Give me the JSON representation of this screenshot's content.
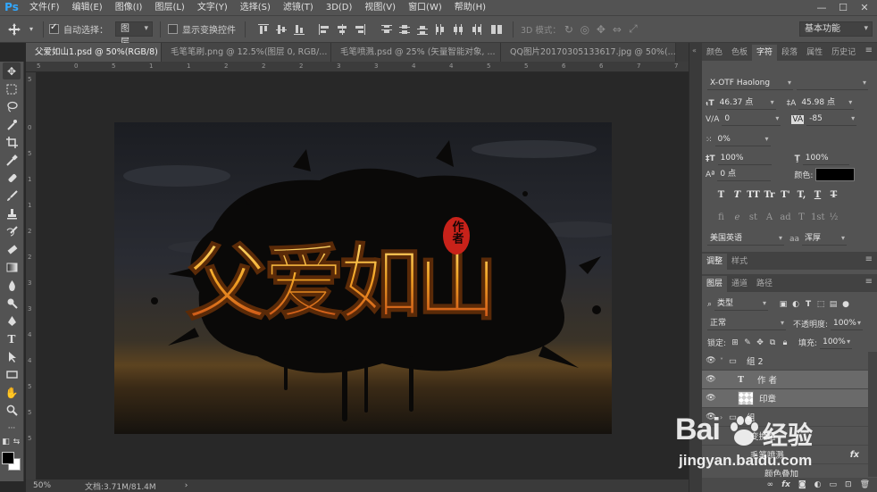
{
  "app": {
    "logo": "Ps"
  },
  "menu": [
    "文件(F)",
    "编辑(E)",
    "图像(I)",
    "图层(L)",
    "文字(Y)",
    "选择(S)",
    "滤镜(T)",
    "3D(D)",
    "视图(V)",
    "窗口(W)",
    "帮助(H)"
  ],
  "window_controls": {
    "minimize": "—",
    "maximize": "☐",
    "close": "✕"
  },
  "options": {
    "auto_select_label": "自动选择：",
    "auto_select_checked": true,
    "auto_select_target": "图层",
    "show_transform_label": "显示变换控件",
    "show_transform_checked": false,
    "mode_3d_label": "3D 模式：",
    "workspace": "基本功能"
  },
  "doc_tabs": [
    {
      "label": "父爱如山1.psd @ 50%(RGB/8)",
      "active": true
    },
    {
      "label": "毛笔笔刷.png @ 12.5%(图层 0, RGB/...",
      "active": false
    },
    {
      "label": "毛笔喷溅.psd @ 25% (矢量智能对象, ...",
      "active": false
    },
    {
      "label": "QQ图片20170305133617.jpg @ 50%(...",
      "active": false
    }
  ],
  "ruler": {
    "top_ticks": [
      "5",
      "0",
      "5",
      "1",
      "1",
      "2",
      "2",
      "2",
      "3",
      "3",
      "4",
      "4",
      "5",
      "5",
      "6",
      "6",
      "7",
      "7"
    ],
    "left_ticks": [
      "5",
      "0",
      "5",
      "1",
      "1",
      "2",
      "2",
      "3",
      "3",
      "4",
      "4",
      "5",
      "5",
      "5"
    ]
  },
  "artwork": {
    "title_text": "父爱如山",
    "seal_text": "作者"
  },
  "status": {
    "zoom": "50%",
    "doc_size": "文档:3.71M/81.4M",
    "arrow": "›"
  },
  "character_panel": {
    "tabs": [
      {
        "label": "颜色",
        "active": false
      },
      {
        "label": "色板",
        "active": false
      },
      {
        "label": "字符",
        "active": true
      },
      {
        "label": "段落",
        "active": false
      },
      {
        "label": "属性",
        "active": false
      },
      {
        "label": "历史记",
        "active": false
      }
    ],
    "font_family": "X-OTF Haolong",
    "font_size": "46.37 点",
    "leading": "45.98 点",
    "kerning": "0",
    "tracking": "-85",
    "tsume": "0%",
    "vertical_scale": "100%",
    "horizontal_scale": "100%",
    "baseline_shift": "0 点",
    "color_label": "颜色:",
    "color_value": "#000000",
    "style_buttons": [
      "T",
      "T",
      "TT",
      "Tr",
      "T'",
      "T,",
      "T",
      "T"
    ],
    "ot_buttons": [
      "fi",
      "ℯ",
      "st",
      "A",
      "ad",
      "T",
      "1st",
      "½"
    ],
    "language": "美国英语",
    "antialias_prefix": "aa",
    "antialias": "浑厚"
  },
  "adjust_panel": {
    "tabs": [
      {
        "label": "调整",
        "active": true
      },
      {
        "label": "样式",
        "active": false
      }
    ]
  },
  "layers_panel": {
    "tabs": [
      {
        "label": "图层",
        "active": true
      },
      {
        "label": "通道",
        "active": false
      },
      {
        "label": "路径",
        "active": false
      }
    ],
    "filter_kind": "类型",
    "blend_mode": "正常",
    "opacity_label": "不透明度:",
    "opacity": "100%",
    "lock_label": "锁定:",
    "fill_label": "填充:",
    "fill": "100%",
    "layers": [
      {
        "name": "组 2",
        "kind": "group",
        "selected": false
      },
      {
        "name": "作 者",
        "kind": "text",
        "selected": true
      },
      {
        "name": "印章",
        "kind": "pixel",
        "selected": true
      },
      {
        "name": "组",
        "kind": "group",
        "selected": false
      },
      {
        "name": "变换组",
        "kind": "layer",
        "selected": false
      },
      {
        "name": "毛笔喷溅",
        "kind": "layer",
        "selected": false
      },
      {
        "name": "颜色叠加",
        "kind": "effect",
        "selected": false
      }
    ],
    "fx_label": "fx"
  },
  "watermark": {
    "brand": "Bai",
    "brand2": "经验",
    "url": "jingyan.baidu.com"
  }
}
